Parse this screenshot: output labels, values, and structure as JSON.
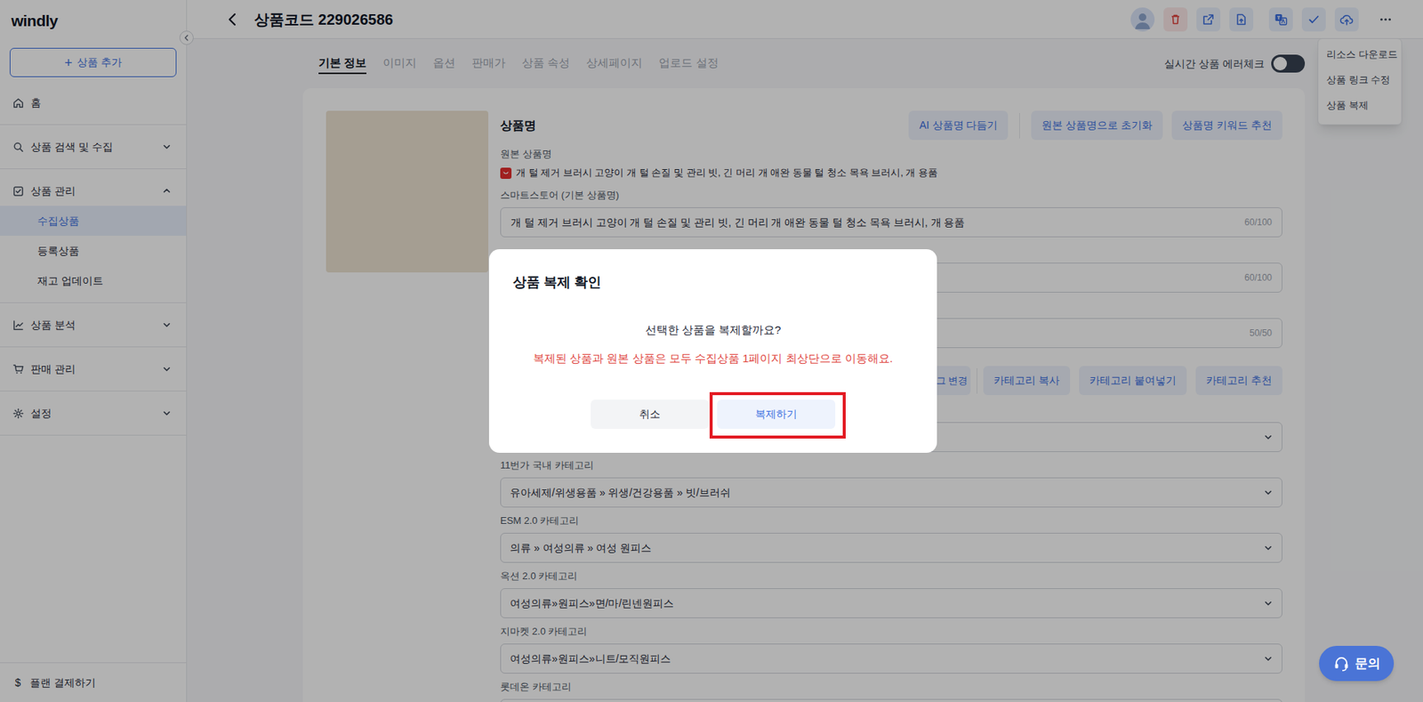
{
  "app": {
    "logo": "windly",
    "add_button": {
      "icon": "+",
      "label": "상품 추가"
    }
  },
  "sidebar": {
    "items": [
      {
        "label": "홈",
        "kind": "link",
        "selected": false
      },
      {
        "label": "상품 검색 및 수집",
        "kind": "group",
        "expanded": false,
        "selected": false
      },
      {
        "label": "상품 관리",
        "kind": "group",
        "expanded": true,
        "selected": false
      },
      {
        "label": "수집상품",
        "kind": "sub",
        "selected": true
      },
      {
        "label": "등록상품",
        "kind": "sub",
        "selected": false
      },
      {
        "label": "재고 업데이트",
        "kind": "sub",
        "selected": false
      },
      {
        "label": "상품 분석",
        "kind": "group",
        "expanded": false,
        "selected": false
      },
      {
        "label": "판매 관리",
        "kind": "group",
        "expanded": false,
        "selected": false
      },
      {
        "label": "설정",
        "kind": "group",
        "expanded": false,
        "selected": false
      }
    ],
    "footer": {
      "icon": "$",
      "label": "플랜 결제하기"
    }
  },
  "header": {
    "title": "상품코드 229026586",
    "menu": {
      "open": true,
      "items": [
        "리소스 다운로드",
        "상품 링크 수정",
        "상품 복제"
      ]
    }
  },
  "tabs": [
    {
      "label": "기본 정보",
      "selected": true
    },
    {
      "label": "이미지",
      "selected": false
    },
    {
      "label": "옵션",
      "selected": false
    },
    {
      "label": "판매가",
      "selected": false
    },
    {
      "label": "상품 속성",
      "selected": false
    },
    {
      "label": "상세페이지",
      "selected": false
    },
    {
      "label": "업로드 설정",
      "selected": false
    }
  ],
  "error_check": {
    "label": "실시간 상품 에러체크",
    "on": false
  },
  "product_name": {
    "title": "상품명",
    "buttons": [
      "AI 상품명 다듬기",
      "원본 상품명으로 초기화",
      "상품명 키워드 추천"
    ],
    "original_label": "원본 상품명",
    "original_name": "개 털 제거 브러시 고양이 개 털 손질 및 관리 빗, 긴 머리 개 애완 동물 털 청소 목욕 브러시, 개 용품",
    "fields": [
      {
        "label": "스마트스토어 (기본 상품명)",
        "value": "개 털 제거 브러시 고양이 개 털 손질 및 관리 빗, 긴 머리 개 애완 동물 털 청소 목욕 브러시, 개 용품",
        "count": "60/100"
      },
      {
        "count": "60/100"
      },
      {
        "count": "50/50"
      }
    ]
  },
  "category": {
    "buttons": [
      "리/태그 변경",
      "카테고리 복사",
      "카테고리 붙여넣기",
      "카테고리 추천"
    ],
    "selects": [
      {},
      {
        "label": "11번가 국내 카테고리",
        "value": "유아세제/위생용품 » 위생/건강용품 » 빗/브러쉬"
      },
      {
        "label": "ESM 2.0 카테고리",
        "value": "의류 » 여성의류 » 여성 원피스"
      },
      {
        "label": "옥션 2.0 카테고리",
        "value": "여성의류»원피스»면/마/린넨원피스"
      },
      {
        "label": "지마켓 2.0 카테고리",
        "value": "여성의류»원피스»니트/모직원피스"
      },
      {
        "label": "롯데온 카테고리"
      }
    ]
  },
  "dialog": {
    "title": "상품 복제 확인",
    "message": "선택한 상품을 복제할까요?",
    "warning": "복제된 상품과 원본 상품은 모두 수집상품 1페이지 최상단으로 이동해요.",
    "buttons": [
      {
        "label": "취소",
        "kind": "cancel",
        "highlighted": false
      },
      {
        "label": "복제하기",
        "kind": "confirm",
        "highlighted": true
      }
    ]
  },
  "chat": {
    "label": "문의"
  }
}
